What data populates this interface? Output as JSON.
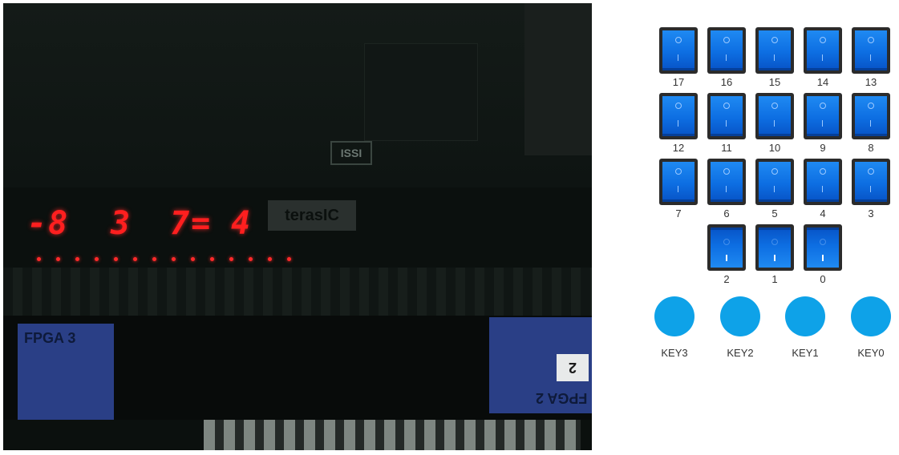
{
  "feed": {
    "hex_display": [
      "-8",
      "3",
      "7=",
      "4"
    ],
    "board_labels": {
      "fpga3": "FPGA 3",
      "fpga2": "FPGA 2",
      "two": "2",
      "terasic": "terasIC",
      "logo": "ISSI"
    },
    "led_count": 14
  },
  "switches": [
    {
      "label": "17",
      "state": "off"
    },
    {
      "label": "16",
      "state": "off"
    },
    {
      "label": "15",
      "state": "off"
    },
    {
      "label": "14",
      "state": "off"
    },
    {
      "label": "13",
      "state": "off"
    },
    {
      "label": "12",
      "state": "off"
    },
    {
      "label": "11",
      "state": "off"
    },
    {
      "label": "10",
      "state": "off"
    },
    {
      "label": "9",
      "state": "off"
    },
    {
      "label": "8",
      "state": "off"
    },
    {
      "label": "7",
      "state": "off"
    },
    {
      "label": "6",
      "state": "off"
    },
    {
      "label": "5",
      "state": "off"
    },
    {
      "label": "4",
      "state": "off"
    },
    {
      "label": "3",
      "state": "off"
    },
    {
      "label": "2",
      "state": "on"
    },
    {
      "label": "1",
      "state": "on"
    },
    {
      "label": "0",
      "state": "on"
    }
  ],
  "keys": [
    {
      "label": "KEY3"
    },
    {
      "label": "KEY2"
    },
    {
      "label": "KEY1"
    },
    {
      "label": "KEY0"
    }
  ],
  "colors": {
    "switch_blue": "#0d6ee2",
    "key_blue": "#0ea2e8",
    "hex_red": "#ff1f1f"
  }
}
